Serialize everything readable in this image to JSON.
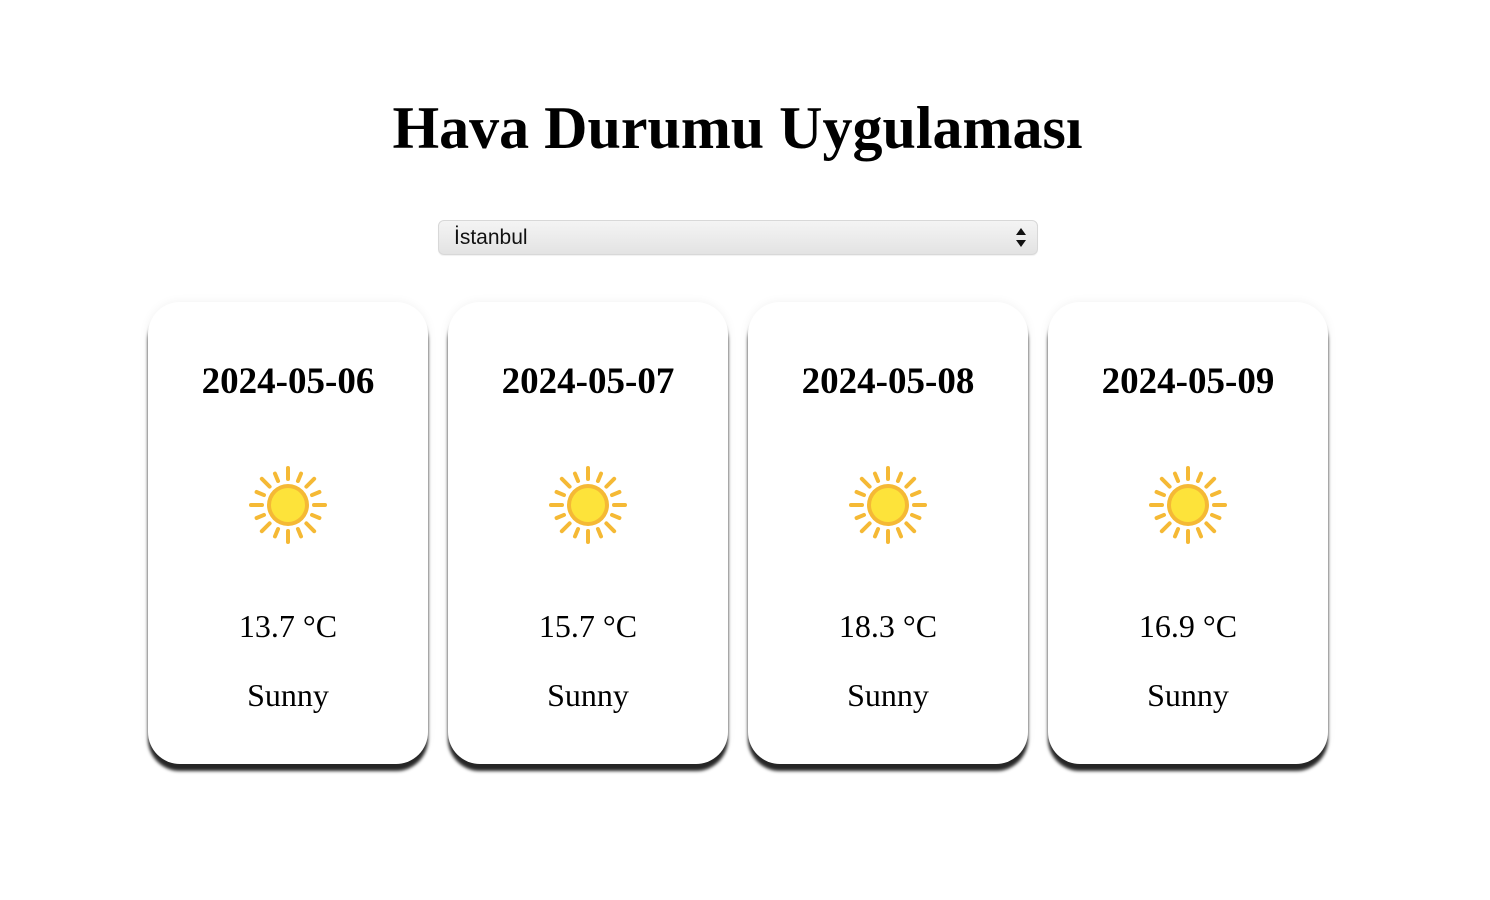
{
  "app": {
    "title": "Hava Durumu Uygulaması"
  },
  "city_select": {
    "selected": "İstanbul"
  },
  "forecast": [
    {
      "date": "2024-05-06",
      "icon": "sun-icon",
      "temperature": "13.7 °C",
      "condition": "Sunny"
    },
    {
      "date": "2024-05-07",
      "icon": "sun-icon",
      "temperature": "15.7 °C",
      "condition": "Sunny"
    },
    {
      "date": "2024-05-08",
      "icon": "sun-icon",
      "temperature": "18.3 °C",
      "condition": "Sunny"
    },
    {
      "date": "2024-05-09",
      "icon": "sun-icon",
      "temperature": "16.9 °C",
      "condition": "Sunny"
    }
  ],
  "colors": {
    "sun_core": "#fde33a",
    "sun_rays": "#f5b935"
  }
}
